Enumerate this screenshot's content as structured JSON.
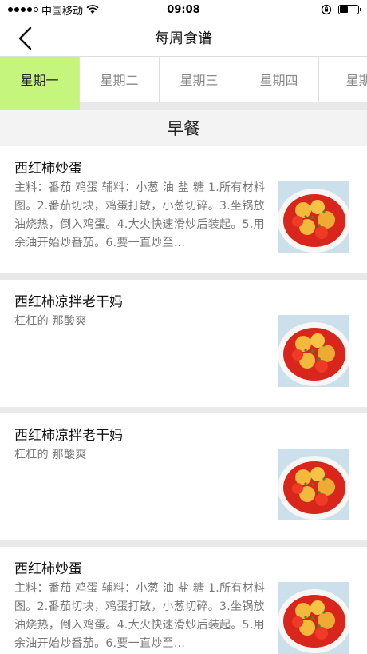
{
  "status_bar": {
    "carrier": "中国移动",
    "time": "09:08"
  },
  "header": {
    "title": "每周食谱",
    "back_icon": "chevron-left-icon"
  },
  "tabs": [
    {
      "label": "星期一",
      "active": true
    },
    {
      "label": "星期二",
      "active": false
    },
    {
      "label": "星期三",
      "active": false
    },
    {
      "label": "星期四",
      "active": false
    },
    {
      "label": "星期",
      "active": false
    }
  ],
  "section": {
    "title": "早餐"
  },
  "recipes": [
    {
      "title": "西红柿炒蛋",
      "description": "主料：番茄 鸡蛋 辅料：小葱 油 盐 糖 1.所有材料图。2.番茄切块，鸡蛋打散，小葱切碎。3.坐锅放油烧热，倒入鸡蛋。4.大火快速滑炒后装起。5.用余油开始炒番茄。6.要一直炒至..."
    },
    {
      "title": "西红柿凉拌老干妈",
      "description": "杠杠的 那酸爽"
    },
    {
      "title": "西红柿凉拌老干妈",
      "description": "杠杠的 那酸爽"
    },
    {
      "title": "西红柿炒蛋",
      "description": "主料：番茄 鸡蛋 辅料：小葱 油 盐 糖 1.所有材料图。2.番茄切块，鸡蛋打散，小葱切碎。3.坐锅放油烧热，倒入鸡蛋。4.大火快速滑炒后装起。5.用余油开始炒番茄。6.要一直炒至..."
    }
  ],
  "colors": {
    "accent": "#c6f57d",
    "separator": "#e9e9e9"
  }
}
